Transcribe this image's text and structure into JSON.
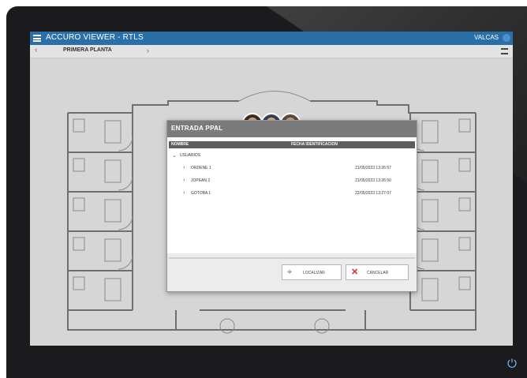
{
  "app": {
    "title": "ACCURO VIEWER - RTLS",
    "user": "VALCAS"
  },
  "subbar": {
    "floor": "PRIMERA PLANTA",
    "back_icon": "chevron-left-icon",
    "next_icon": "chevron-right-icon",
    "filter_icon": "filter-icon"
  },
  "dialog": {
    "title": "ENTRADA PPAL",
    "columns": {
      "name": "NOMBRE",
      "date": "FECHA IDENTIFICACION"
    },
    "root": {
      "label": "USUARIOS",
      "children": [
        {
          "label": "ORDENE 1",
          "date": "21/05/2023 13:26:57"
        },
        {
          "label": "JOPEAN 2",
          "date": "21/05/2023 13:26:50"
        },
        {
          "label": "GOTOBA 1",
          "date": "22/05/2023 13:27:07"
        }
      ]
    },
    "buttons": {
      "locate": "LOCALIZAR",
      "cancel": "CANCELAR"
    }
  },
  "colors": {
    "titlebar": "#2a6fa8",
    "dialog_header": "#7b7b7b",
    "cancel_accent": "#d3262c"
  }
}
